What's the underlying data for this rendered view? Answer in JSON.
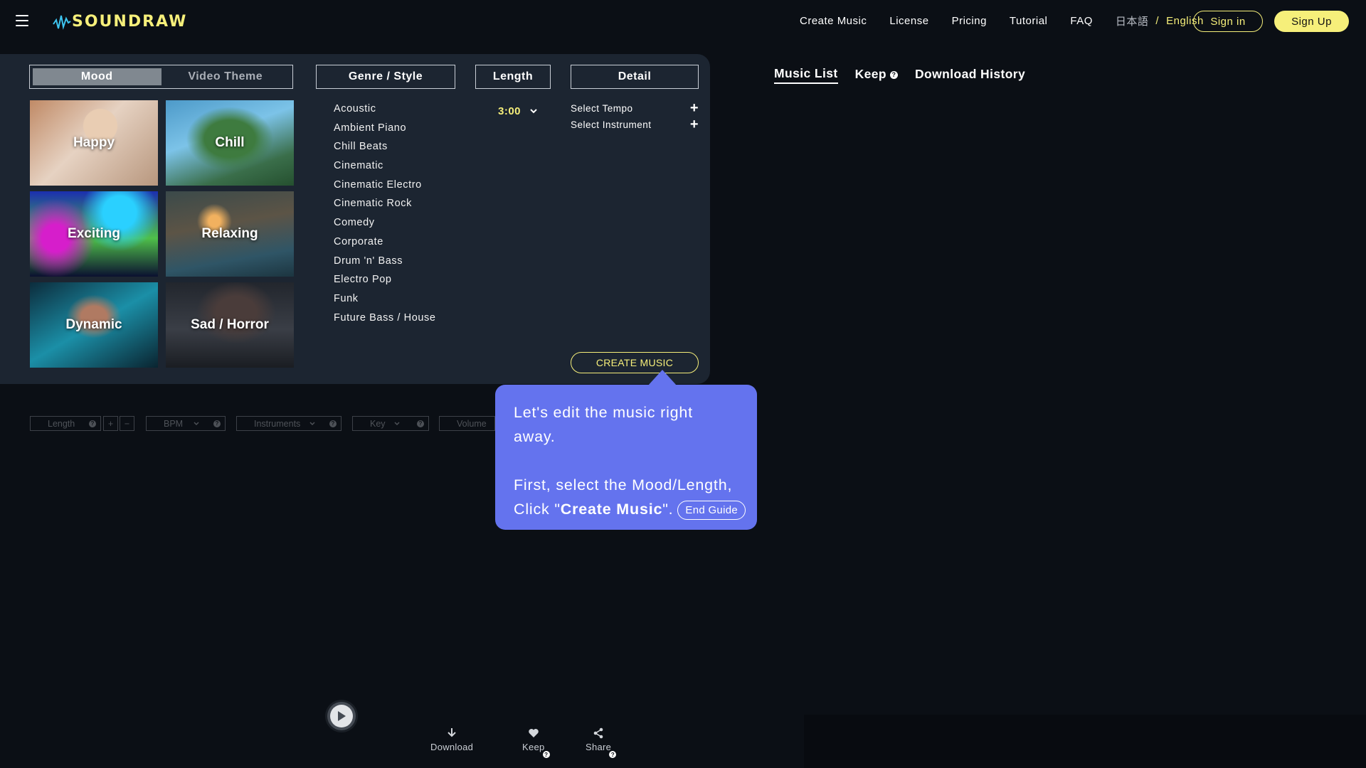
{
  "header": {
    "logo": "SOUNDRAW",
    "nav": [
      "Create Music",
      "License",
      "Pricing",
      "Tutorial",
      "FAQ"
    ],
    "lang_other": "日本語",
    "lang_sep": "/",
    "lang_active": "English",
    "signin": "Sign in",
    "signup": "Sign Up"
  },
  "panel": {
    "mood_tabs": {
      "mood": "Mood",
      "video_theme": "Video Theme"
    },
    "genre_tab": "Genre / Style",
    "length_tab": "Length",
    "detail_tab": "Detail",
    "moods": [
      "Happy",
      "Chill",
      "Exciting",
      "Relaxing",
      "Dynamic",
      "Sad / Horror"
    ],
    "genres": [
      "Acoustic",
      "Ambient Piano",
      "Chill Beats",
      "Cinematic",
      "Cinematic Electro",
      "Cinematic Rock",
      "Comedy",
      "Corporate",
      "Drum 'n' Bass",
      "Electro Pop",
      "Funk",
      "Future Bass / House"
    ],
    "length_value": "3:00",
    "detail": {
      "tempo": "Select Tempo",
      "instrument": "Select Instrument"
    },
    "create_button": "CREATE MUSIC"
  },
  "right_tabs": {
    "music_list": "Music List",
    "keep": "Keep",
    "download_history": "Download History"
  },
  "toolbar": {
    "length": "Length",
    "bpm": "BPM",
    "instruments": "Instruments",
    "key": "Key",
    "volume": "Volume"
  },
  "guide": {
    "line1": "Let's edit the music right away.",
    "line2": "First, select the Mood/Length,",
    "line3_prefix": "Click \"",
    "line3_bold": "Create Music",
    "line3_suffix": "\".",
    "end": "End Guide"
  },
  "player": {
    "download": "Download",
    "keep": "Keep",
    "share": "Share"
  },
  "colors": {
    "accent": "#f6ef7a",
    "panel": "#1c2531",
    "guide": "#6473ee",
    "background": "#0b0f15"
  }
}
